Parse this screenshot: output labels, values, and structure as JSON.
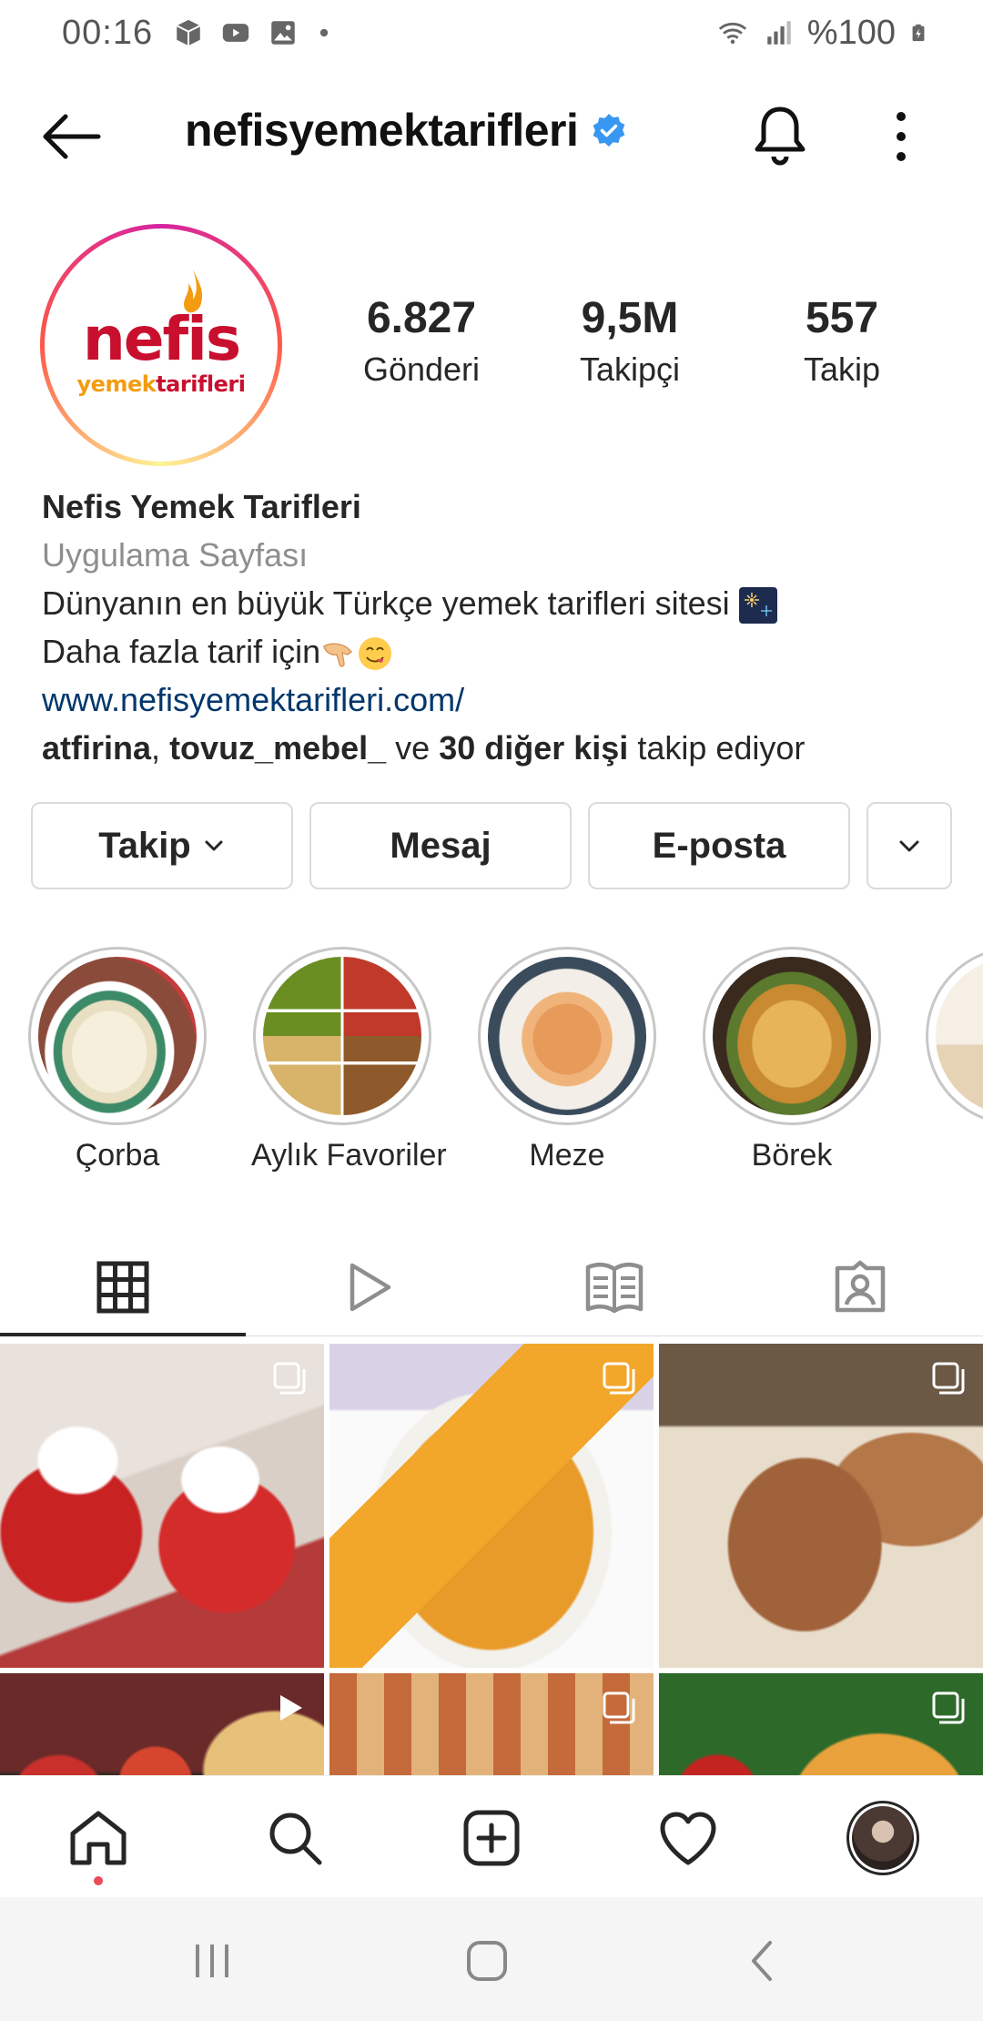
{
  "status_bar": {
    "time": "00:16",
    "battery": "%100",
    "icons": [
      "box-icon",
      "youtube-icon",
      "gallery-icon",
      "dot-icon",
      "wifi-icon",
      "signal-icon",
      "battery-icon"
    ]
  },
  "header": {
    "username": "nefisyemektarifleri",
    "verified": true,
    "icons": [
      "back-arrow-icon",
      "verified-badge-icon",
      "bell-icon",
      "more-vertical-icon"
    ]
  },
  "profile": {
    "logo_text_main": "nefis",
    "logo_text_sub_1": "yemek",
    "logo_text_sub_2": "tarifleri",
    "stats": [
      {
        "value": "6.827",
        "label": "Gönderi"
      },
      {
        "value": "9,5M",
        "label": "Takipçi"
      },
      {
        "value": "557",
        "label": "Takip"
      }
    ],
    "name": "Nefis Yemek Tarifleri",
    "category": "Uygulama Sayfası",
    "bio_line_1": "Dünyanın en büyük Türkçe yemek tarifleri sitesi",
    "bio_line_2": "Daha fazla tarif için",
    "link": "www.nefisyemektarifleri.com/",
    "followed_by": {
      "user_1": "atfirina",
      "sep": ",",
      "user_2": "tovuz_mebel_",
      "conj": "ve",
      "others": "30 diğer kişi",
      "suffix": "takip ediyor"
    }
  },
  "actions": {
    "follow": "Takip",
    "message": "Mesaj",
    "email": "E-posta"
  },
  "highlights": [
    {
      "label": "Çorba"
    },
    {
      "label": "Aylık Favoriler"
    },
    {
      "label": "Meze"
    },
    {
      "label": "Börek"
    }
  ],
  "tabs": [
    "grid-icon",
    "reels-icon",
    "guide-icon",
    "tagged-icon"
  ],
  "bottom_nav": [
    "home-icon",
    "search-icon",
    "add-post-icon",
    "heart-icon",
    "profile-avatar"
  ],
  "colors": {
    "verified": "#3897f0",
    "link": "#00376b",
    "brand_red": "#c8102e",
    "notification": "#ed4956"
  }
}
